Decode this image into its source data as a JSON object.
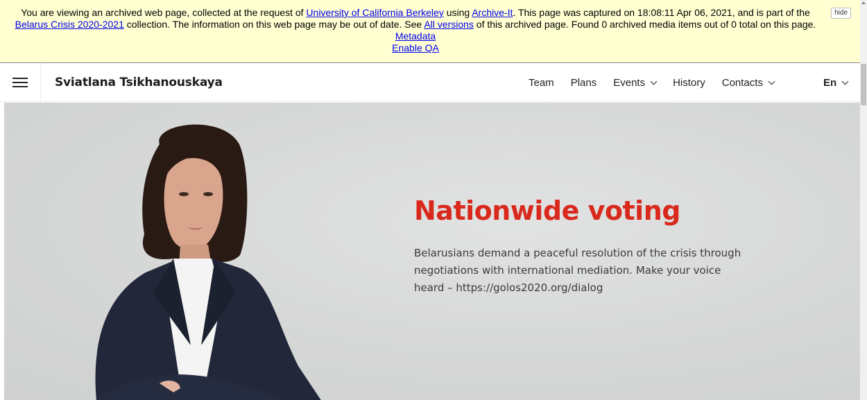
{
  "archive_banner": {
    "text_1": "You are viewing an archived web page, collected at the request of ",
    "link_institution": "University of California Berkeley",
    "text_2": " using ",
    "link_archive_it": "Archive-It",
    "text_3": ". This page was captured on 18:08:11 Apr 06, 2021, and is part of the ",
    "link_collection": "Belarus Crisis 2020-2021",
    "text_4": " collection. The information on this web page may be out of date. See ",
    "link_all_versions": "All versions",
    "text_5": " of this archived page. Found 0 archived media items out of 0 total on this page. ",
    "link_metadata": "Metadata",
    "link_enable_qa": "Enable QA",
    "hide_label": "hide"
  },
  "header": {
    "brand": "Sviatlana Tsikhanouskaya",
    "nav": [
      {
        "label": "Team"
      },
      {
        "label": "Plans"
      },
      {
        "label": "Events"
      },
      {
        "label": "History"
      },
      {
        "label": "Contacts"
      }
    ],
    "language": "En"
  },
  "hero": {
    "title": "Nationwide voting",
    "text": "Belarusians demand a peaceful resolution of the crisis through negotiations with international mediation. Make your voice heard – https://golos2020.org/dialog"
  },
  "colors": {
    "banner_bg": "#ffffd2",
    "link": "#0000ee",
    "accent": "#d9291c",
    "hero_bg": "#d6d7d7"
  }
}
